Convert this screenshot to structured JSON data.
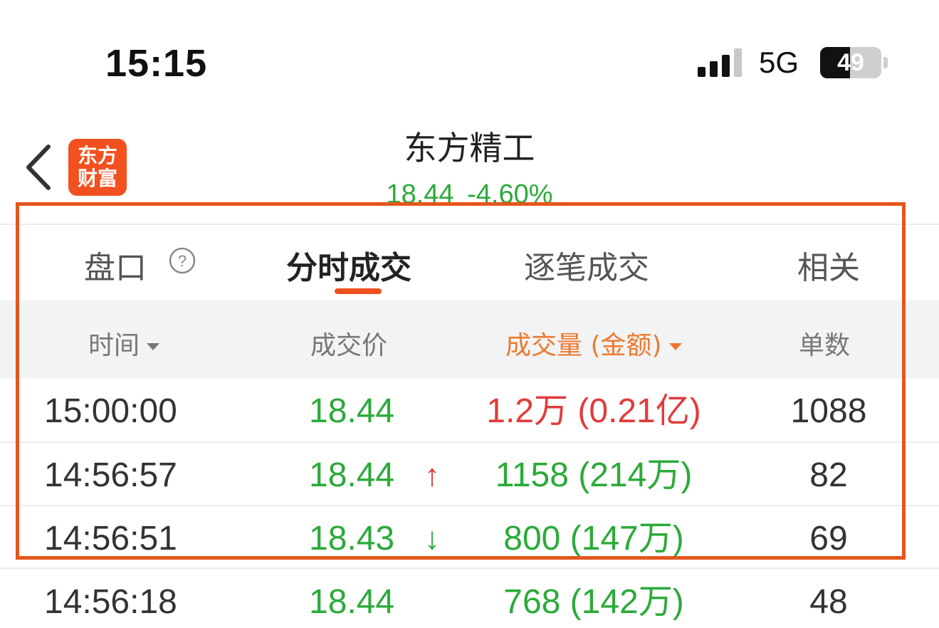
{
  "status_bar": {
    "time": "15:15",
    "network": "5G",
    "battery": "49",
    "battery_level": 0.49
  },
  "header": {
    "logo_line1": "东方",
    "logo_line2": "财富",
    "title": "东方精工",
    "price": "18.44",
    "change": "-4.60%"
  },
  "tabs": [
    {
      "label": "盘口"
    },
    {
      "label": "分时成交"
    },
    {
      "label": "逐笔成交"
    },
    {
      "label": "相关"
    }
  ],
  "columns": {
    "time": "时间",
    "price": "成交价",
    "volume": "成交量 (金额)",
    "count": "单数"
  },
  "rows": [
    {
      "time": "15:00:00",
      "price": "18.44",
      "arrow": "",
      "volume": "1.2万 (0.21亿)",
      "count": "1088"
    },
    {
      "time": "14:56:57",
      "price": "18.44",
      "arrow": "↑",
      "volume": "1158 (214万)",
      "count": "82"
    },
    {
      "time": "14:56:51",
      "price": "18.43",
      "arrow": "↓",
      "volume": "800 (147万)",
      "count": "69"
    },
    {
      "time": "14:56:18",
      "price": "18.44",
      "arrow": "",
      "volume": "768 (142万)",
      "count": "48"
    }
  ],
  "colors": {
    "accent": "#f2501e",
    "up": "#e23b3b",
    "down": "#2caa3a",
    "highlight": "#e4561c"
  }
}
